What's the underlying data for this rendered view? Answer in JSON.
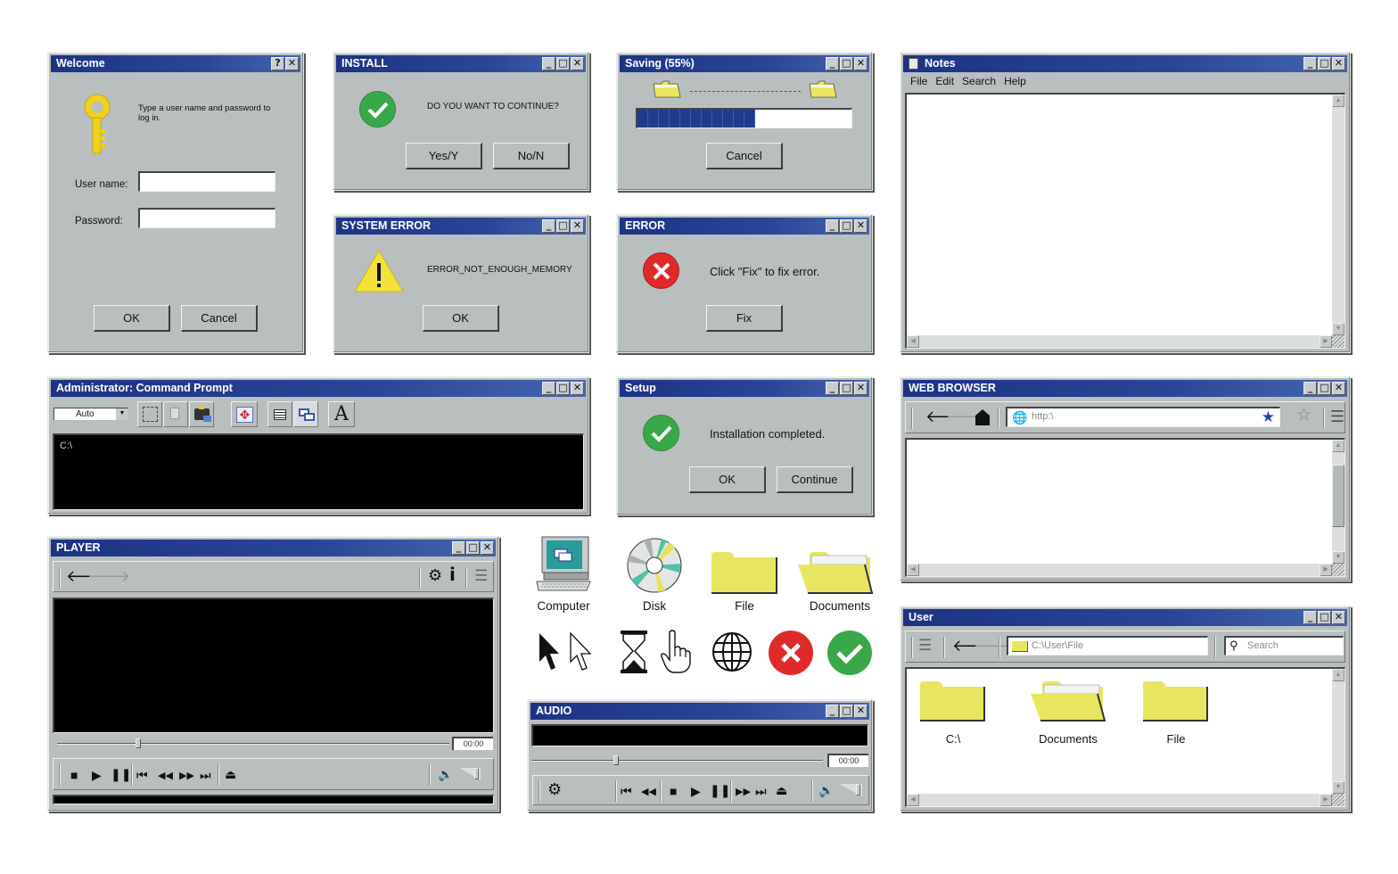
{
  "welcome": {
    "title": "Welcome",
    "title_buttons": [
      "?",
      "✕"
    ],
    "message": "Type a user name and password to log in.",
    "username_label": "User name:",
    "username_value": "",
    "password_label": "Password:",
    "password_value": "",
    "ok": "OK",
    "cancel": "Cancel",
    "icon": "key-icon"
  },
  "install": {
    "title": "INSTALL",
    "message": "DO YOU WANT TO CONTINUE?",
    "yes": "Yes/Y",
    "no": "No/N",
    "icon": "check-circle-icon"
  },
  "saving": {
    "title": "Saving (55%)",
    "progress_percent": 55,
    "progress_segments_filled": 11,
    "cancel": "Cancel"
  },
  "system_error": {
    "title": "SYSTEM ERROR",
    "message": "ERROR_NOT_ENOUGH_MEMORY",
    "ok": "OK",
    "icon": "warning-icon"
  },
  "error": {
    "title": "ERROR",
    "message": "Click \"Fix\" to fix error.",
    "fix": "Fix",
    "icon": "error-circle-icon"
  },
  "notes": {
    "title": "Notes",
    "menu": [
      "File",
      "Edit",
      "Search",
      "Help"
    ],
    "content": ""
  },
  "cmd": {
    "title": "Administrator: Command Prompt",
    "font_select": "Auto",
    "prompt": "C:\\",
    "font_button": "A"
  },
  "setup": {
    "title": "Setup",
    "message": "Installation completed.",
    "ok": "OK",
    "continue": "Continue"
  },
  "browser": {
    "title": "WEB BROWSER",
    "url": "http:\\"
  },
  "player": {
    "title": "PLAYER",
    "time": "00:00",
    "seek_fraction": 0.2,
    "info_label": "i"
  },
  "desktop_icons": [
    {
      "label": "Computer",
      "icon": "computer-icon"
    },
    {
      "label": "Disk",
      "icon": "disk-icon"
    },
    {
      "label": "File",
      "icon": "folder-icon"
    },
    {
      "label": "Documents",
      "icon": "open-folder-icon"
    }
  ],
  "cursor_icons": [
    "arrow-cursor-black",
    "arrow-cursor-white",
    "hourglass",
    "hand-pointer",
    "globe",
    "error-circle",
    "check-circle"
  ],
  "audio": {
    "title": "AUDIO",
    "time": "00:00",
    "seek_fraction": 0.28
  },
  "user": {
    "title": "User",
    "path": "C:\\User\\File",
    "search_placeholder": "Search",
    "items": [
      {
        "label": "C:\\",
        "type": "folder"
      },
      {
        "label": "Documents",
        "type": "open-folder"
      },
      {
        "label": "File",
        "type": "folder"
      }
    ]
  },
  "colors": {
    "titlebar": "#1d3384",
    "window_bg": "#b9bebf",
    "progress": "#1f3c8c",
    "folder": "#e8e661",
    "success": "#3aa84a",
    "error": "#e02a2a",
    "warning": "#f2e23a"
  }
}
